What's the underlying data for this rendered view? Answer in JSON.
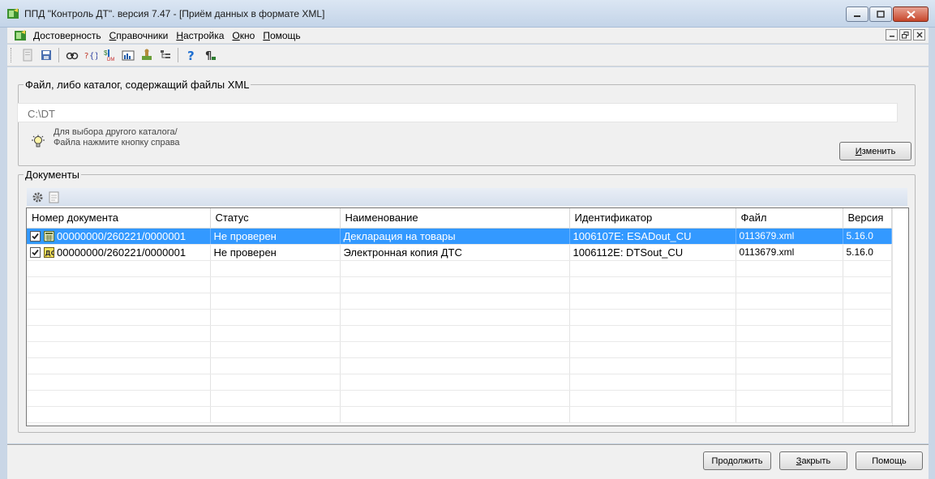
{
  "window": {
    "title": "ППД \"Контроль ДТ\". версия 7.47 - [Приём данных в формате XML]"
  },
  "menu": {
    "items": [
      "Достоверность",
      "Справочники",
      "Настройка",
      "Окно",
      "Помощь"
    ]
  },
  "toolbar": {
    "icons": [
      "new-doc-icon",
      "save-icon",
      "view-icon",
      "xml-check-icon",
      "convert-icon",
      "report-icon",
      "stamp-icon",
      "tree-icon",
      "help-icon",
      "info-icon"
    ]
  },
  "file_group": {
    "legend": "Файл, либо каталог, содержащий файлы XML",
    "path": "C:\\DT",
    "hint": "Для выбора другого каталога/Файла нажмите кнопку справа",
    "change_button": "Изменить"
  },
  "documents": {
    "legend": "Документы",
    "columns": [
      "Номер документа",
      "Статус",
      "Наименование",
      "Идентификатор",
      "Файл",
      "Версия"
    ],
    "rows": [
      {
        "number": "00000000/260221/0000001",
        "status": "Не проверен",
        "name": "Декларация на товары",
        "id": "1006107E: ESADout_CU",
        "file": "0113679.xml",
        "version": "5.16.0",
        "checked": true,
        "selected": true
      },
      {
        "number": "00000000/260221/0000001",
        "status": "Не проверен",
        "name": "Электронная копия ДТС",
        "id": "1006112E: DTSout_CU",
        "file": "0113679.xml",
        "version": "5.16.0",
        "checked": true,
        "selected": false
      }
    ]
  },
  "buttons": {
    "continue": "Продолжить",
    "close": "Закрыть",
    "help": "Помощь"
  },
  "colors": {
    "selection": "#3399ff",
    "titlebar": "#c3d4e8",
    "close_button": "#c7462a"
  }
}
